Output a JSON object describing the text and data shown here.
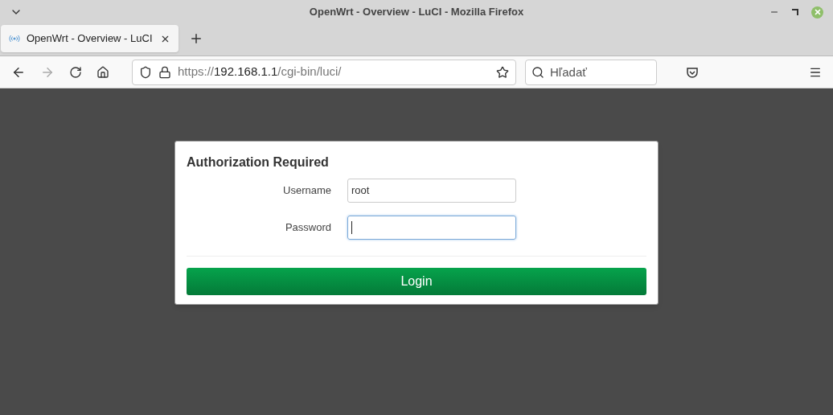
{
  "window": {
    "title": "OpenWrt - Overview - LuCI - Mozilla Firefox"
  },
  "tabs": [
    {
      "label": "OpenWrt - Overview - LuCI",
      "selected": true
    }
  ],
  "address_bar": {
    "scheme": "https://",
    "host": "192.168.1.1",
    "path": "/cgi-bin/luci/"
  },
  "search": {
    "placeholder": "Hľadať"
  },
  "login": {
    "title": "Authorization Required",
    "fields": [
      {
        "label": "Username",
        "value": "root",
        "focused": false
      },
      {
        "label": "Password",
        "focused": true
      }
    ],
    "button": "Login"
  }
}
